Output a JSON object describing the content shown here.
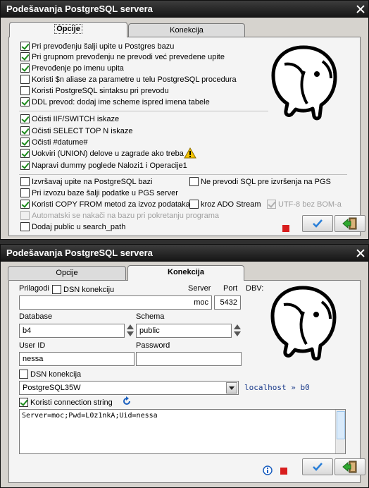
{
  "window1": {
    "title": "Podešavanja PostgreSQL servera",
    "tabs": [
      "Opcije",
      "Konekcija"
    ],
    "group1": [
      {
        "label": "Pri prevođenju šalji upite u Postgres bazu",
        "checked": true
      },
      {
        "label": "Pri grupnom prevođenju ne prevodi već prevedene upite",
        "checked": true
      },
      {
        "label": "Prevođenje po imenu upita",
        "checked": true
      },
      {
        "label": "Koristi $n aliase za parametre u telu PostgreSQL procedura",
        "checked": false
      },
      {
        "label": "Koristi PostgreSQL sintaksu pri prevodu",
        "checked": false
      },
      {
        "label": "DDL prevod: dodaj ime scheme ispred imena tabele",
        "checked": true
      }
    ],
    "group2": [
      {
        "label": "Očisti IIF/SWITCH iskaze",
        "checked": true
      },
      {
        "label": "Očisti SELECT TOP N iskaze",
        "checked": true
      },
      {
        "label": "Očisti #datume#",
        "checked": true
      },
      {
        "label": "Uokviri (UNION) delove u zagrade ako treba",
        "checked": true
      },
      {
        "label": "Napravi dummy poglede Nalozi1 i Operacije1",
        "checked": true
      }
    ],
    "group3": {
      "izvrsavaj": {
        "label": "Izvršavaj upite na PostgreSQL bazi",
        "checked": false
      },
      "ne_prevodi": {
        "label": "Ne prevodi SQL pre izvršenja na PGS",
        "checked": false
      },
      "pri_izvozu": {
        "label": "Pri izvozu baze šalji podatke u PGS server",
        "checked": false
      },
      "copy_from": {
        "label": "Koristi COPY FROM metod za izvoz podataka",
        "checked": true
      },
      "ado_stream": {
        "label": "kroz ADO Stream",
        "checked": false
      },
      "utf8": {
        "label": "UTF-8 bez BOM-a",
        "checked": true
      },
      "auto": {
        "label": "Automatski se nakači na bazu pri pokretanju programa",
        "checked": false
      },
      "public": {
        "label": "Dodaj public u search_path",
        "checked": false
      }
    }
  },
  "window2": {
    "title": "Podešavanja PostgreSQL servera",
    "tabs": [
      "Opcije",
      "Konekcija"
    ],
    "prilagodi": "Prilagodi",
    "dsn_konekciju": "DSN konekciju",
    "server_label": "Server",
    "server_value": "moc",
    "port_label": "Port",
    "port_value": "5432",
    "dbv_label": "DBV:",
    "database_label": "Database",
    "database_value": "b4",
    "schema_label": "Schema",
    "schema_value": "public",
    "userid_label": "User ID",
    "userid_value": "nessa",
    "password_label": "Password",
    "password_value": "",
    "dsn_konekcija": "DSN konekcija",
    "dsn_select": "PostgreSQL35W",
    "dsn_info": "localhost » b0",
    "koristi_conn": "Koristi connection string",
    "conn_string": "Server=moc;Pwd=L0z1nkA;Uid=nessa"
  },
  "colors": {
    "titlebar": "#1e1e1e",
    "check": "#1a8a1a",
    "stop": "#d81e1e",
    "info": "#1a5fbf",
    "ok": "#2a7fd8"
  },
  "icons": [
    "close-icon",
    "elephant-logo",
    "warning-icon",
    "ok-icon",
    "exit-icon",
    "stop-icon",
    "refresh-icon",
    "info-icon",
    "chevron-down-icon"
  ]
}
